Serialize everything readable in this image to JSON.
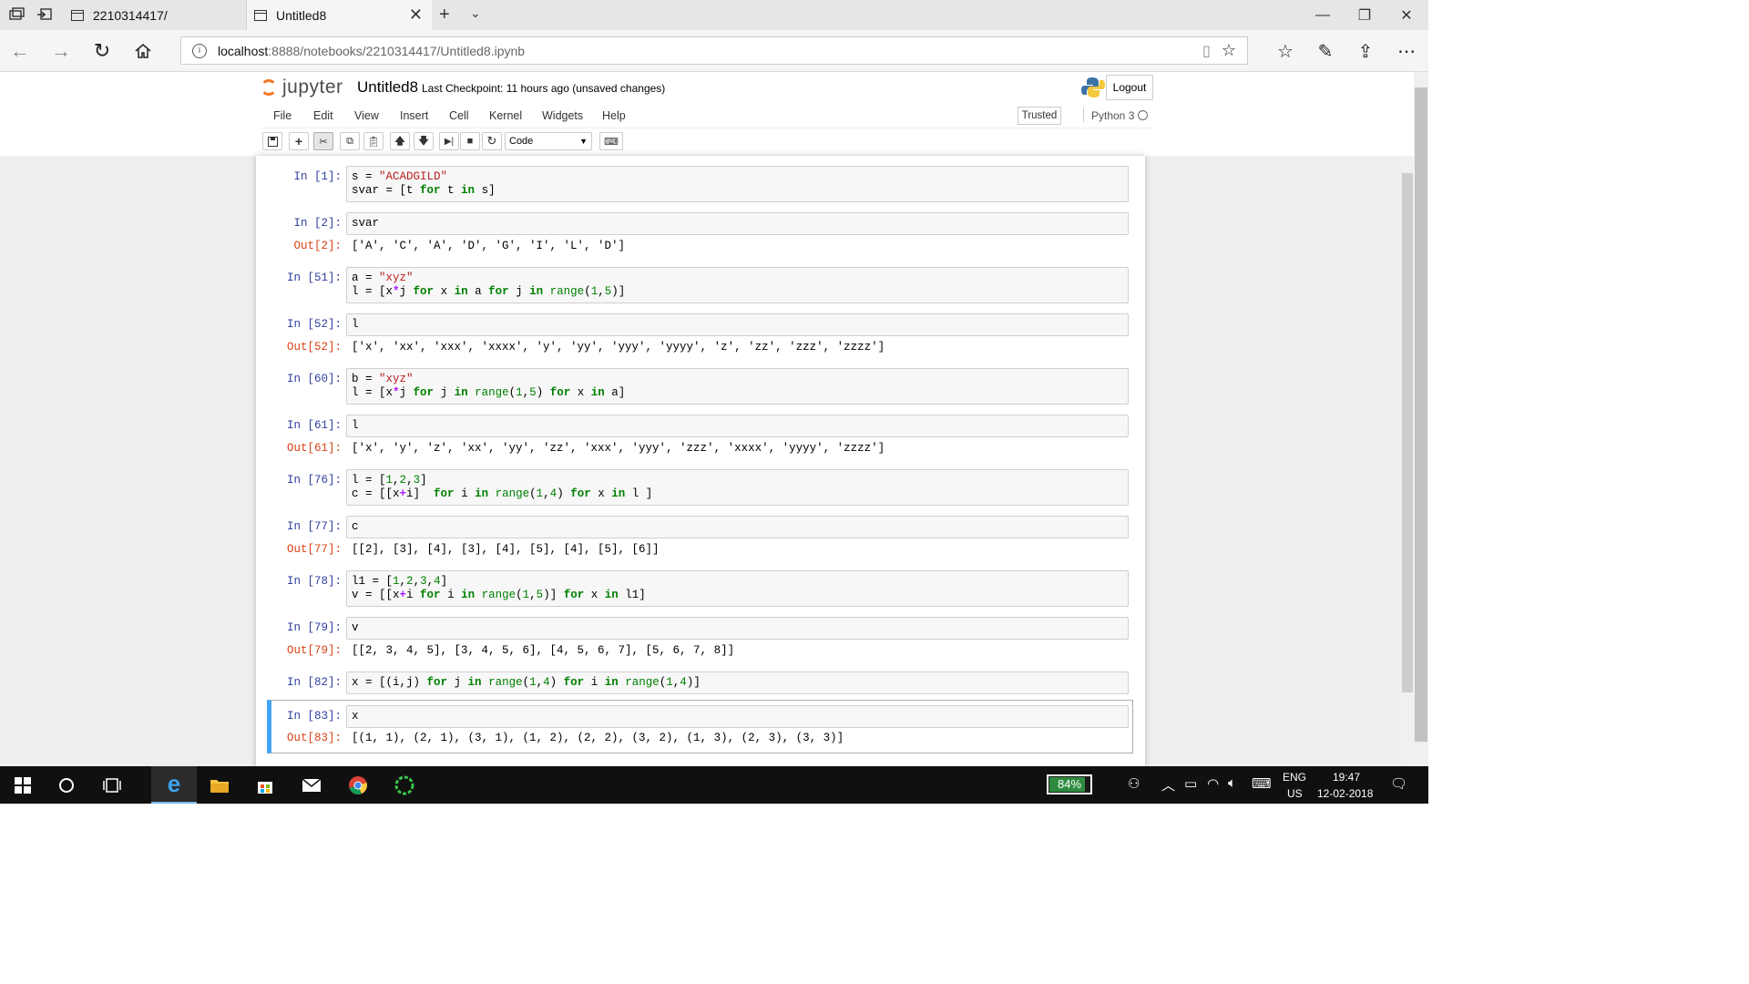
{
  "browser": {
    "tabs": [
      {
        "title": "2210314417/",
        "active": false
      },
      {
        "title": "Untitled8",
        "active": true
      }
    ],
    "url_host": "localhost",
    "url_rest": ":8888/notebooks/2210314417/Untitled8.ipynb",
    "window_controls": {
      "minimize": "—",
      "maximize": "❐",
      "close": "✕"
    }
  },
  "jupyter": {
    "logo_text": "jupyter",
    "notebook_name": "Untitled8",
    "checkpoint": "Last Checkpoint: 11 hours ago (unsaved changes)",
    "logout_label": "Logout",
    "menu": [
      "File",
      "Edit",
      "View",
      "Insert",
      "Cell",
      "Kernel",
      "Widgets",
      "Help"
    ],
    "trusted_label": "Trusted",
    "kernel_name": "Python 3",
    "cell_type": "Code"
  },
  "cells": [
    {
      "in": "In [1]:",
      "code": [
        "s = \"ACADGILD\"",
        "svar = [t for t in s]"
      ],
      "out": ""
    },
    {
      "in": "In [2]:",
      "code": [
        "svar"
      ],
      "out_prompt": "Out[2]:",
      "out": "['A', 'C', 'A', 'D', 'G', 'I', 'L', 'D']"
    },
    {
      "in": "In [51]:",
      "code": [
        "a = \"xyz\"",
        "l = [x*j for x in a for j in range(1,5)]"
      ]
    },
    {
      "in": "In [52]:",
      "code": [
        "l"
      ],
      "out_prompt": "Out[52]:",
      "out": "['x', 'xx', 'xxx', 'xxxx', 'y', 'yy', 'yyy', 'yyyy', 'z', 'zz', 'zzz', 'zzzz']"
    },
    {
      "in": "In [60]:",
      "code": [
        "b = \"xyz\"",
        "l = [x*j for j in range(1,5) for x in a]"
      ]
    },
    {
      "in": "In [61]:",
      "code": [
        "l"
      ],
      "out_prompt": "Out[61]:",
      "out": "['x', 'y', 'z', 'xx', 'yy', 'zz', 'xxx', 'yyy', 'zzz', 'xxxx', 'yyyy', 'zzzz']"
    },
    {
      "in": "In [76]:",
      "code": [
        "l = [1,2,3]",
        "c = [[x+i]  for i in range(1,4) for x in l ]"
      ]
    },
    {
      "in": "In [77]:",
      "code": [
        "c"
      ],
      "out_prompt": "Out[77]:",
      "out": "[[2], [3], [4], [3], [4], [5], [4], [5], [6]]"
    },
    {
      "in": "In [78]:",
      "code": [
        "l1 = [1,2,3,4]",
        "v = [[x+i for i in range(1,5)] for x in l1]"
      ]
    },
    {
      "in": "In [79]:",
      "code": [
        "v"
      ],
      "out_prompt": "Out[79]:",
      "out": "[[2, 3, 4, 5], [3, 4, 5, 6], [4, 5, 6, 7], [5, 6, 7, 8]]"
    },
    {
      "in": "In [82]:",
      "code": [
        "x = [(i,j) for j in range(1,4) for i in range(1,4)]"
      ]
    },
    {
      "in": "In [83]:",
      "code": [
        "x"
      ],
      "out_prompt": "Out[83]:",
      "out": "[(1, 1), (2, 1), (3, 1), (1, 2), (2, 2), (3, 2), (1, 3), (2, 3), (3, 3)]"
    }
  ],
  "taskbar": {
    "battery": "84%",
    "battery_level": 0.84,
    "lang1": "ENG",
    "lang2": "US",
    "time": "19:47",
    "date": "12-02-2018"
  },
  "colors": {
    "accent_selected_cell": "#42a5f5",
    "prompt_in": "#303f9f",
    "prompt_out": "#d84315"
  }
}
